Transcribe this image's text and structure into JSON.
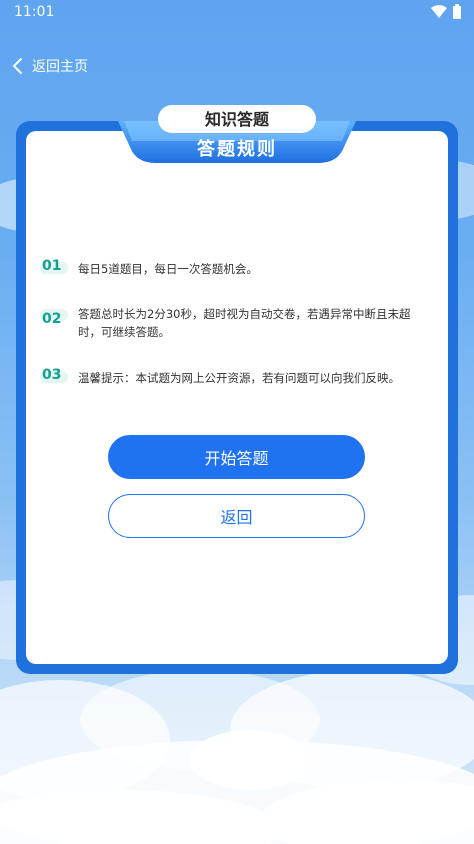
{
  "status_bar": {
    "time": "11:01"
  },
  "nav": {
    "back_label": "返回主页"
  },
  "banner": {
    "top_title": "知识答题",
    "main_title": "答题规则"
  },
  "rules": [
    {
      "num": "01",
      "text": "每日5道题目，每日一次答题机会。"
    },
    {
      "num": "02",
      "text": "答题总时长为2分30秒，超时视为自动交卷，若遇异常中断且未超时，可继续答题。"
    },
    {
      "num": "03",
      "text": "温馨提示：本试题为网上公开资源，若有问题可以向我们反映。"
    }
  ],
  "buttons": {
    "start_label": "开始答题",
    "back_label": "返回"
  },
  "colors": {
    "primary": "#1f72f0",
    "frame": "#1f72dc",
    "number": "#12a18f"
  }
}
